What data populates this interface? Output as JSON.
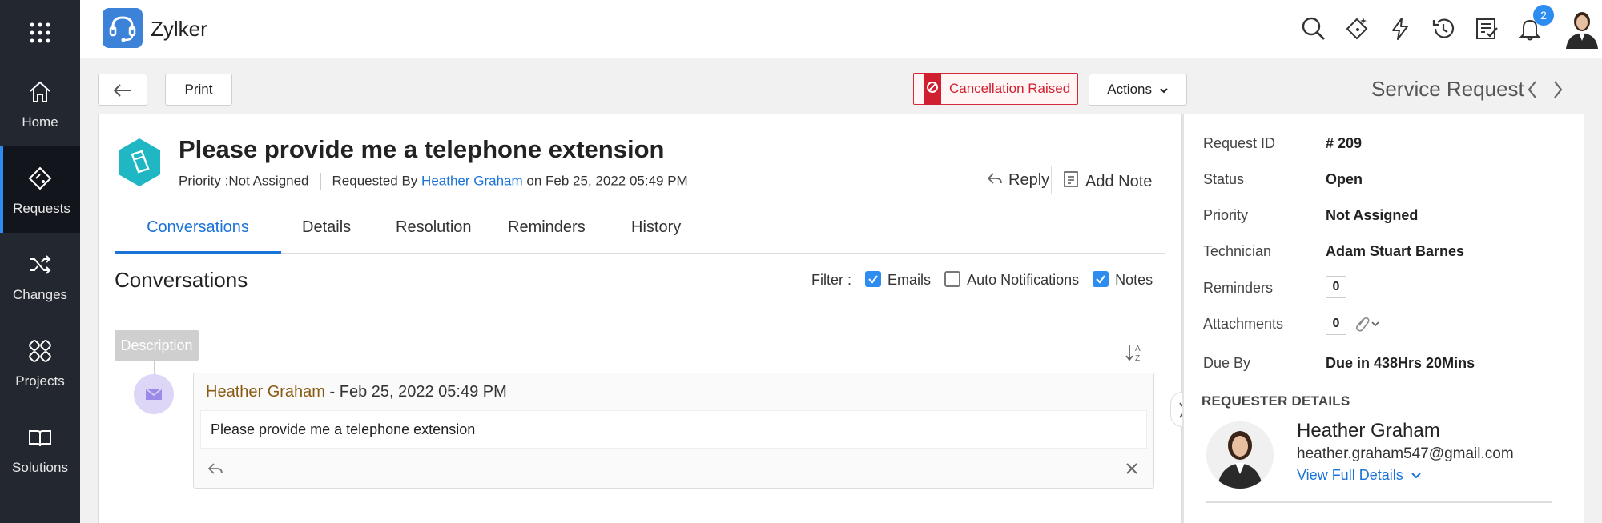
{
  "nav": {
    "items": [
      {
        "label": "Home",
        "icon": "home-icon"
      },
      {
        "label": "Requests",
        "icon": "requests-icon",
        "active": true
      },
      {
        "label": "Changes",
        "icon": "changes-icon"
      },
      {
        "label": "Projects",
        "icon": "projects-icon"
      },
      {
        "label": "Solutions",
        "icon": "solutions-icon"
      }
    ]
  },
  "topbar": {
    "brand": "Zylker",
    "notification_count": "2",
    "icons": [
      "search-icon",
      "magic-icon",
      "lightning-icon",
      "history-icon",
      "checklist-icon",
      "bell-icon"
    ]
  },
  "toolbar": {
    "print_label": "Print",
    "cancellation_label": "Cancellation Raised",
    "actions_label": "Actions",
    "section_title": "Service Request"
  },
  "request": {
    "title": "Please provide me a telephone extension",
    "priority_text": "Priority :Not Assigned",
    "requested_by_prefix": "Requested By",
    "requester_link": "Heather Graham",
    "date_text": "on Feb 25, 2022 05:49 PM",
    "reply_label": "Reply",
    "add_note_label": "Add Note"
  },
  "tabs": [
    {
      "label": "Conversations",
      "active": true
    },
    {
      "label": "Details"
    },
    {
      "label": "Resolution"
    },
    {
      "label": "Reminders"
    },
    {
      "label": "History"
    }
  ],
  "conversations": {
    "heading": "Conversations",
    "filter_label": "Filter :",
    "filters": [
      {
        "label": "Emails",
        "checked": true
      },
      {
        "label": "Auto Notifications",
        "checked": false
      },
      {
        "label": "Notes",
        "checked": true
      }
    ],
    "description_tag": "Description",
    "message": {
      "author": "Heather Graham",
      "date": " - Feb 25, 2022 05:49 PM",
      "body": "Please provide me a telephone extension"
    }
  },
  "properties": {
    "request_id_label": "Request ID",
    "request_id_value": "# 209",
    "status_label": "Status",
    "status_value": "Open",
    "priority_label": "Priority",
    "priority_value": "Not Assigned",
    "technician_label": "Technician",
    "technician_value": "Adam Stuart Barnes",
    "reminders_label": "Reminders",
    "reminders_value": "0",
    "attachments_label": "Attachments",
    "attachments_value": "0",
    "due_by_label": "Due By",
    "due_by_value": "Due in 438Hrs 20Mins"
  },
  "requester": {
    "heading": "REQUESTER DETAILS",
    "name": "Heather Graham",
    "email": "heather.graham547@gmail.com",
    "view_link": "View Full Details"
  },
  "colors": {
    "accent": "#1a73d8",
    "nav_bg": "#232830",
    "cancel_red": "#d02030",
    "ticket_teal": "#1fb7c3"
  }
}
